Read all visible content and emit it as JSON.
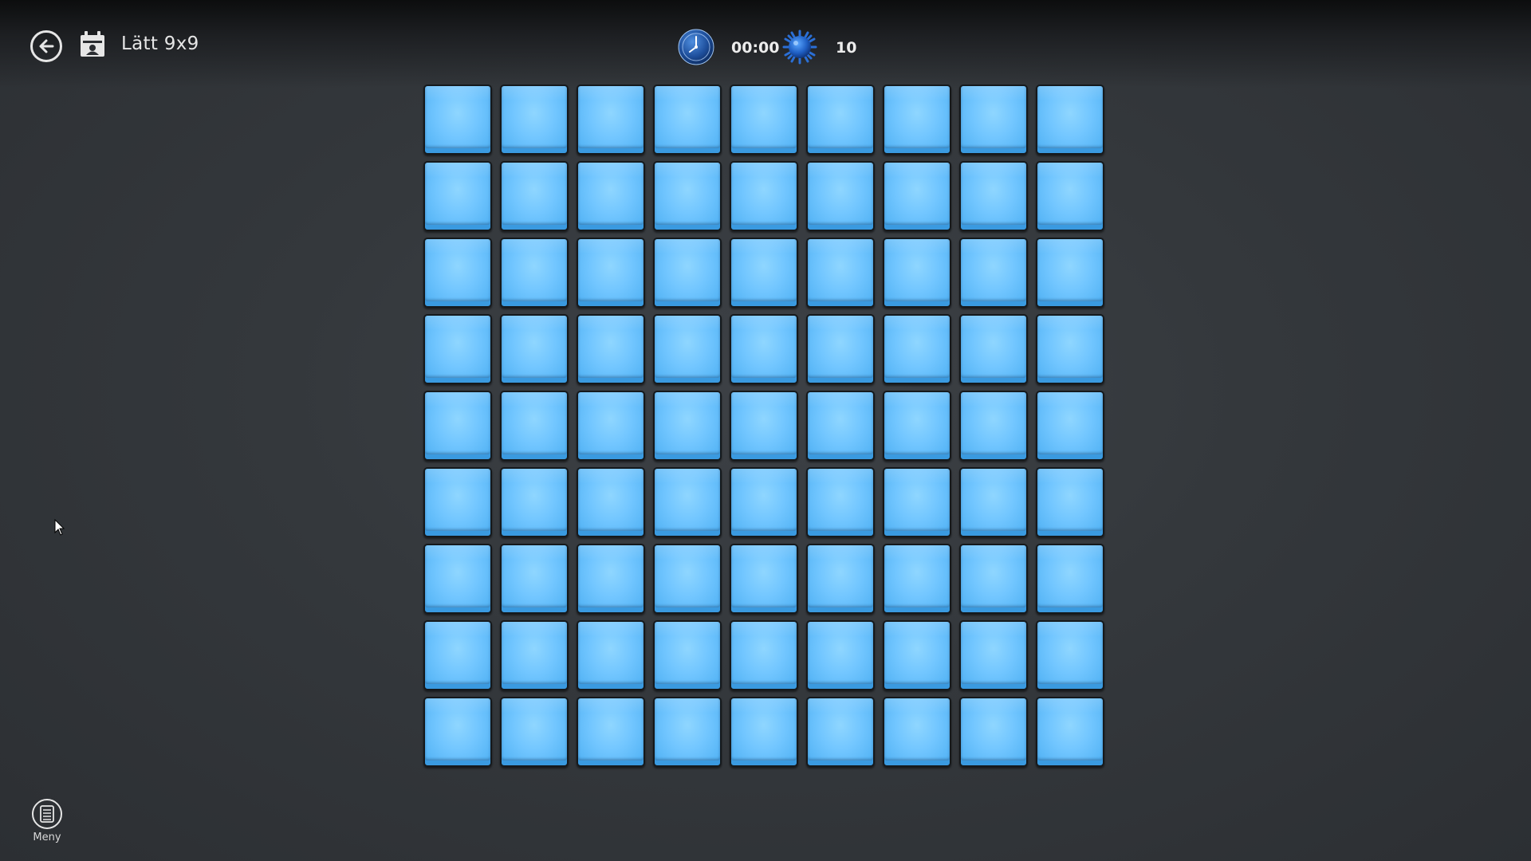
{
  "header": {
    "title": "Lätt 9x9",
    "back_icon": "back-arrow-icon",
    "mode_icon": "calendar-icon"
  },
  "status": {
    "timer": "00:00",
    "timer_icon": "clock-icon",
    "mines": "10",
    "mines_icon": "mine-icon"
  },
  "board": {
    "rows": 9,
    "cols": 9,
    "cells": [
      [
        "hidden",
        "hidden",
        "hidden",
        "hidden",
        "hidden",
        "hidden",
        "hidden",
        "hidden",
        "hidden"
      ],
      [
        "hidden",
        "hidden",
        "hidden",
        "hidden",
        "hidden",
        "hidden",
        "hidden",
        "hidden",
        "hidden"
      ],
      [
        "hidden",
        "hidden",
        "hidden",
        "hidden",
        "hidden",
        "hidden",
        "hidden",
        "hidden",
        "hidden"
      ],
      [
        "hidden",
        "hidden",
        "hidden",
        "hidden",
        "hidden",
        "hidden",
        "hidden",
        "hidden",
        "hidden"
      ],
      [
        "hidden",
        "hidden",
        "hidden",
        "hidden",
        "hidden",
        "hidden",
        "hidden",
        "hidden",
        "hidden"
      ],
      [
        "hidden",
        "hidden",
        "hidden",
        "hidden",
        "hidden",
        "hidden",
        "hidden",
        "hidden",
        "hidden"
      ],
      [
        "hidden",
        "hidden",
        "hidden",
        "hidden",
        "hidden",
        "hidden",
        "hidden",
        "hidden",
        "hidden"
      ],
      [
        "hidden",
        "hidden",
        "hidden",
        "hidden",
        "hidden",
        "hidden",
        "hidden",
        "hidden",
        "hidden"
      ],
      [
        "hidden",
        "hidden",
        "hidden",
        "hidden",
        "hidden",
        "hidden",
        "hidden",
        "hidden",
        "hidden"
      ]
    ],
    "tile_color": "#72c6ff"
  },
  "footer": {
    "menu_label": "Meny",
    "menu_icon": "menu-list-icon"
  },
  "colors": {
    "background": "#34383c",
    "text": "#e6e6e6",
    "tile": "#72c6ff"
  }
}
